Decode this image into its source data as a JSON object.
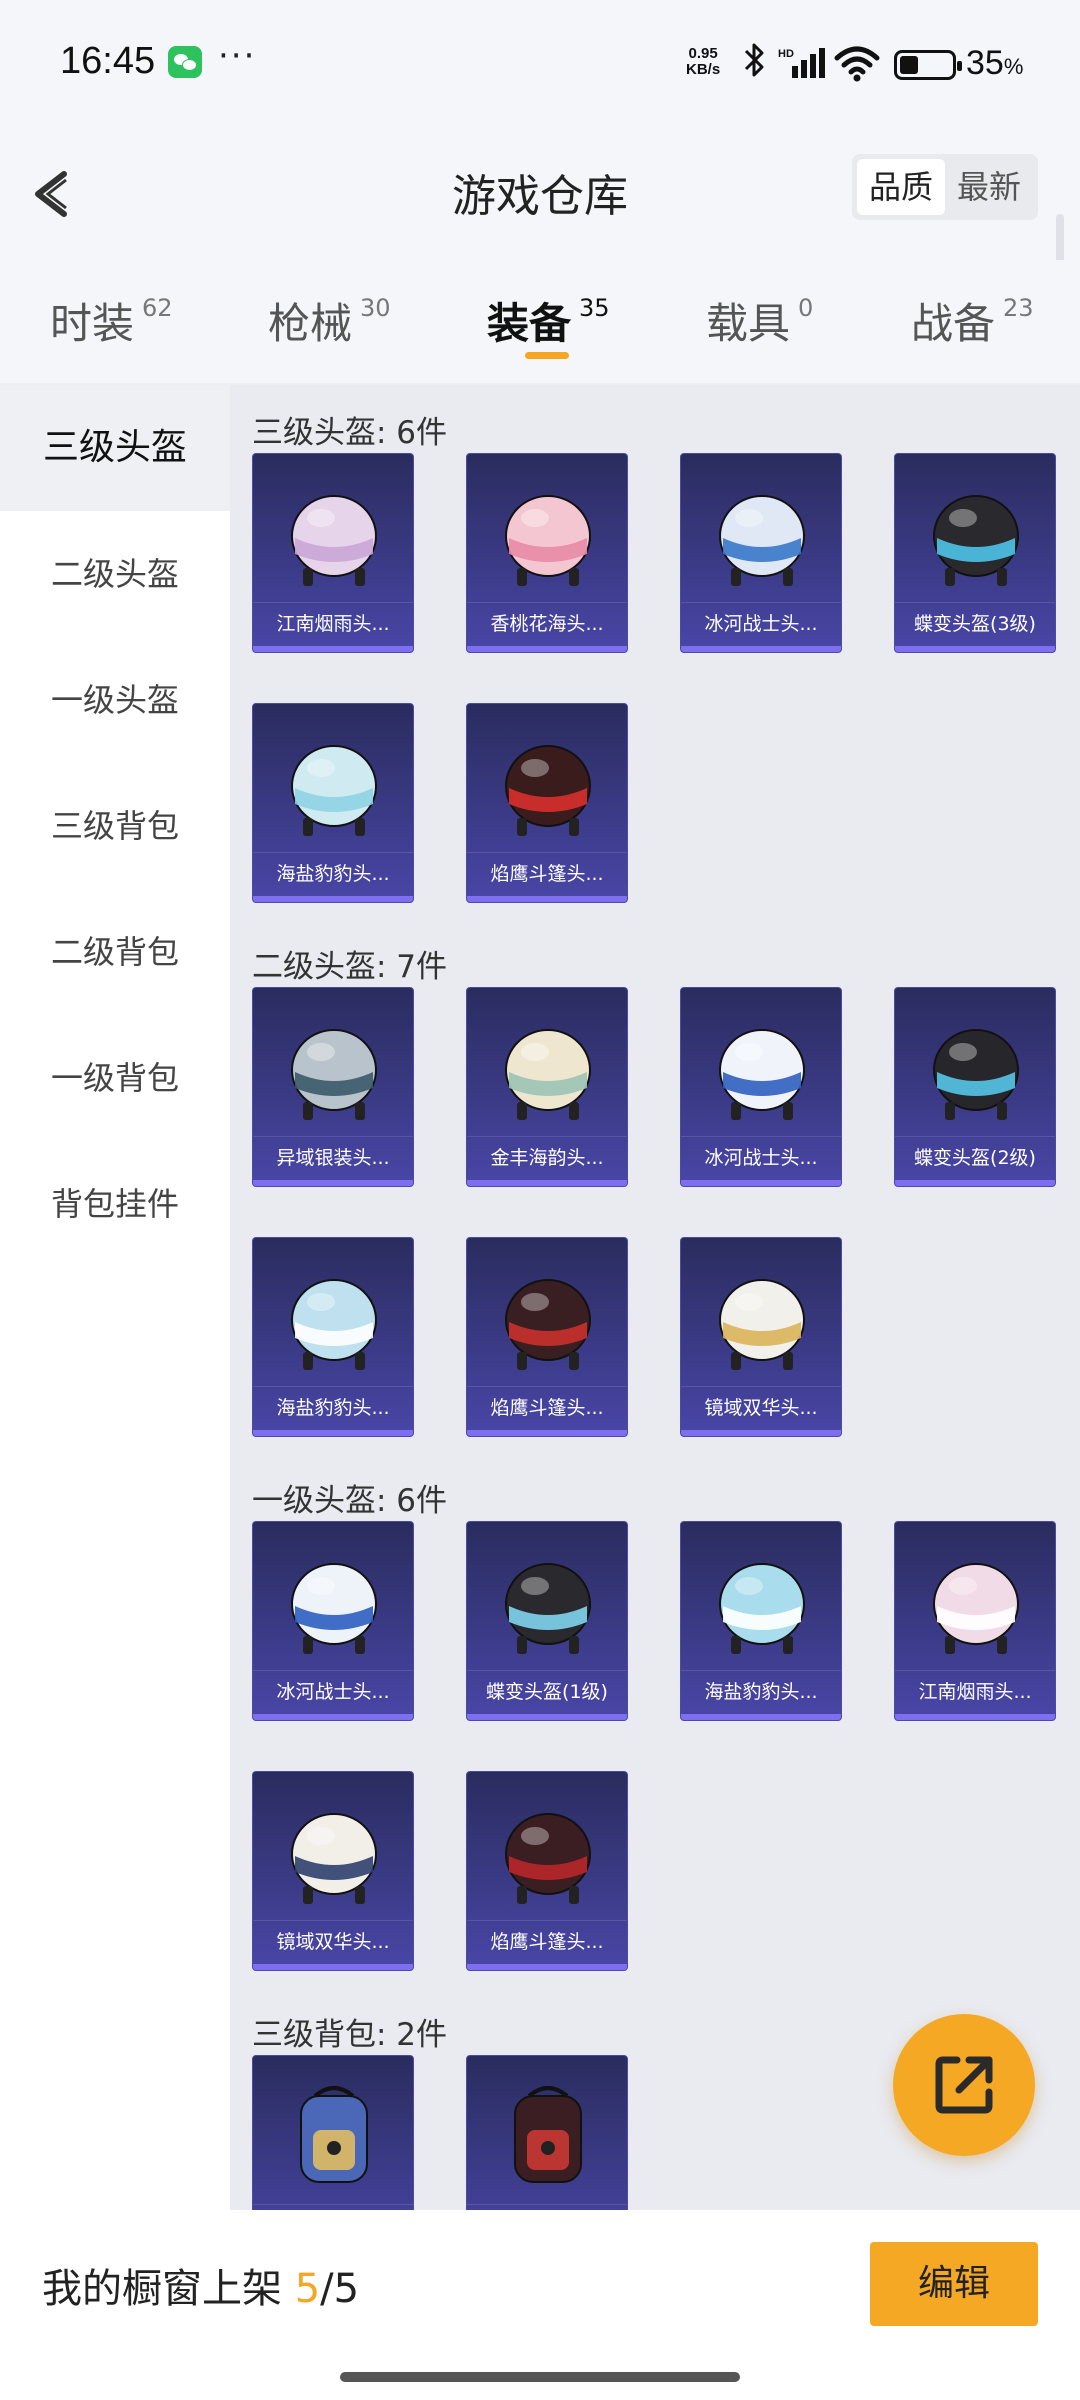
{
  "status_bar": {
    "time": "16:45",
    "net_speed_value": "0.95",
    "net_speed_unit": "KB/s",
    "battery_percent": "35",
    "battery_unit": "%"
  },
  "header": {
    "title": "游戏仓库",
    "sort_options": [
      "品质",
      "最新"
    ],
    "active_sort": "品质"
  },
  "tabs": [
    {
      "label": "时装",
      "count": "62"
    },
    {
      "label": "枪械",
      "count": "30"
    },
    {
      "label": "装备",
      "count": "35",
      "active": true
    },
    {
      "label": "载具",
      "count": "0"
    },
    {
      "label": "战备",
      "count": "23"
    }
  ],
  "sidebar": {
    "items": [
      "三级头盔",
      "二级头盔",
      "一级头盔",
      "三级背包",
      "二级背包",
      "一级背包",
      "背包挂件"
    ],
    "active": "三级头盔"
  },
  "sections": [
    {
      "title": "三级头盔: 6件",
      "items": [
        {
          "name": "江南烟雨头...",
          "color": "#e6d4ea",
          "accent": "#c9a6d6"
        },
        {
          "name": "香桃花海头...",
          "color": "#f4c6d2",
          "accent": "#e88aa6"
        },
        {
          "name": "冰河战士头...",
          "color": "#dfe8f4",
          "accent": "#3a78c9"
        },
        {
          "name": "蝶变头盔(3级)",
          "color": "#2a2a2e",
          "accent": "#4cc3e8"
        },
        {
          "name": "海盐豹豹头...",
          "color": "#cfeaf0",
          "accent": "#8fd3e3"
        },
        {
          "name": "焰鹰斗篷头...",
          "color": "#3a1c1c",
          "accent": "#d9302e"
        }
      ]
    },
    {
      "title": "二级头盔: 7件",
      "items": [
        {
          "name": "异域银装头...",
          "color": "#b8c3cc",
          "accent": "#3b5a6b"
        },
        {
          "name": "金丰海韵头...",
          "color": "#eee6cf",
          "accent": "#9bc3b4"
        },
        {
          "name": "冰河战士头...",
          "color": "#f0f4fa",
          "accent": "#2f5fbf"
        },
        {
          "name": "蝶变头盔(2级)",
          "color": "#27272b",
          "accent": "#56c7e8"
        },
        {
          "name": "海盐豹豹头...",
          "color": "#bfe0ef",
          "accent": "#ffffff"
        },
        {
          "name": "焰鹰斗篷头...",
          "color": "#3a1f22",
          "accent": "#c9302c"
        },
        {
          "name": "镜域双华头...",
          "color": "#f2f0ea",
          "accent": "#d9b45a"
        }
      ]
    },
    {
      "title": "一级头盔: 6件",
      "items": [
        {
          "name": "冰河战士头...",
          "color": "#eef3fa",
          "accent": "#2c5fc0"
        },
        {
          "name": "蝶变头盔(1级)",
          "color": "#2a2a2e",
          "accent": "#7fd4ee"
        },
        {
          "name": "海盐豹豹头...",
          "color": "#a9dcec",
          "accent": "#ffffff"
        },
        {
          "name": "江南烟雨头...",
          "color": "#f1dbe6",
          "accent": "#ffffff"
        },
        {
          "name": "镜域双华头...",
          "color": "#f2efe8",
          "accent": "#2f3f6e"
        },
        {
          "name": "焰鹰斗篷头...",
          "color": "#3b1e22",
          "accent": "#b8262a"
        }
      ]
    },
    {
      "title": "三级背包: 2件",
      "items": [
        {
          "name": "",
          "color": "#4a67b8",
          "accent": "#e9c15a",
          "kind": "backpack"
        },
        {
          "name": "",
          "color": "#3a1e22",
          "accent": "#d23a36",
          "kind": "backpack"
        }
      ]
    }
  ],
  "bottom_bar": {
    "shelf_label": "我的橱窗上架",
    "shelf_current": "5",
    "shelf_sep": "/",
    "shelf_total": "5",
    "edit_label": "编辑"
  }
}
